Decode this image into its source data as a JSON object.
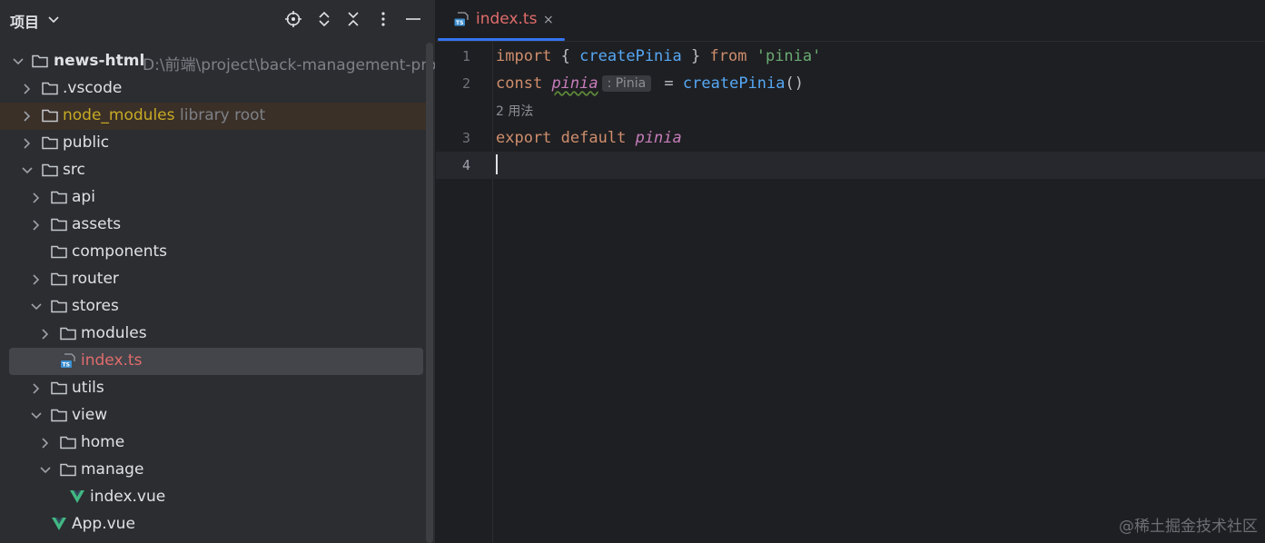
{
  "project_panel": {
    "title": "项目",
    "header_icons": [
      "locate-icon",
      "expand-collapse-icon",
      "close-all-icon",
      "more-icon",
      "minimize-icon"
    ],
    "tree": [
      {
        "name": "news-html",
        "hint": "D:\\前端\\project\\back-management-proj",
        "type": "folder",
        "expanded": true,
        "bold": true
      },
      {
        "name": ".vscode",
        "type": "folder",
        "expanded": false
      },
      {
        "name": "node_modules",
        "hint": "library root",
        "type": "folder",
        "expanded": false
      },
      {
        "name": "public",
        "type": "folder",
        "expanded": false
      },
      {
        "name": "src",
        "type": "folder",
        "expanded": true
      },
      {
        "name": "api",
        "type": "folder",
        "expanded": false
      },
      {
        "name": "assets",
        "type": "folder",
        "expanded": false
      },
      {
        "name": "components",
        "type": "folder"
      },
      {
        "name": "router",
        "type": "folder",
        "expanded": false
      },
      {
        "name": "stores",
        "type": "folder",
        "expanded": true
      },
      {
        "name": "modules",
        "type": "folder",
        "expanded": false
      },
      {
        "name": "index.ts",
        "type": "ts-file",
        "selected": true
      },
      {
        "name": "utils",
        "type": "folder",
        "expanded": false
      },
      {
        "name": "view",
        "type": "folder",
        "expanded": true
      },
      {
        "name": "home",
        "type": "folder",
        "expanded": false
      },
      {
        "name": "manage",
        "type": "folder",
        "expanded": true
      },
      {
        "name": "index.vue",
        "type": "vue-file"
      },
      {
        "name": "App.vue",
        "type": "vue-file"
      }
    ]
  },
  "editor": {
    "tab": {
      "label": "index.ts",
      "close": "×"
    },
    "lines": [
      {
        "number": "1",
        "tokens": [
          "import",
          "{",
          "createPinia",
          "}",
          "from",
          "'pinia'"
        ]
      },
      {
        "number": "2",
        "tokens": [
          "const",
          "pinia",
          ": Pinia",
          "=",
          "createPinia",
          "()"
        ]
      },
      {
        "number": "3",
        "tokens": [
          "export",
          "default",
          "pinia"
        ]
      },
      {
        "number": "4",
        "tokens": []
      }
    ],
    "usages_hint": "2 用法"
  },
  "watermark": "@稀土掘金技术社区",
  "colors": {
    "keyword": "#cf8e6d",
    "function": "#56a8f5",
    "string": "#6aab73",
    "variable": "#c77dbb",
    "accent": "#3574f0",
    "modified_file": "#e06c6c",
    "library_root": "#c8aa24"
  }
}
